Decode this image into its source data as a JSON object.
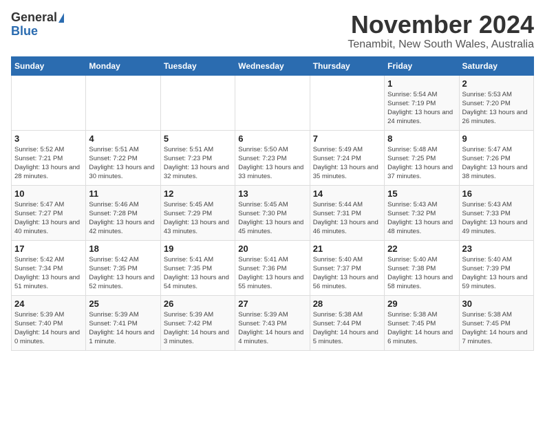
{
  "logo": {
    "general": "General",
    "blue": "Blue"
  },
  "title": {
    "month": "November 2024",
    "location": "Tenambit, New South Wales, Australia"
  },
  "days_of_week": [
    "Sunday",
    "Monday",
    "Tuesday",
    "Wednesday",
    "Thursday",
    "Friday",
    "Saturday"
  ],
  "weeks": [
    [
      {
        "day": "",
        "info": ""
      },
      {
        "day": "",
        "info": ""
      },
      {
        "day": "",
        "info": ""
      },
      {
        "day": "",
        "info": ""
      },
      {
        "day": "",
        "info": ""
      },
      {
        "day": "1",
        "info": "Sunrise: 5:54 AM\nSunset: 7:19 PM\nDaylight: 13 hours\nand 24 minutes."
      },
      {
        "day": "2",
        "info": "Sunrise: 5:53 AM\nSunset: 7:20 PM\nDaylight: 13 hours\nand 26 minutes."
      }
    ],
    [
      {
        "day": "3",
        "info": "Sunrise: 5:52 AM\nSunset: 7:21 PM\nDaylight: 13 hours\nand 28 minutes."
      },
      {
        "day": "4",
        "info": "Sunrise: 5:51 AM\nSunset: 7:22 PM\nDaylight: 13 hours\nand 30 minutes."
      },
      {
        "day": "5",
        "info": "Sunrise: 5:51 AM\nSunset: 7:23 PM\nDaylight: 13 hours\nand 32 minutes."
      },
      {
        "day": "6",
        "info": "Sunrise: 5:50 AM\nSunset: 7:23 PM\nDaylight: 13 hours\nand 33 minutes."
      },
      {
        "day": "7",
        "info": "Sunrise: 5:49 AM\nSunset: 7:24 PM\nDaylight: 13 hours\nand 35 minutes."
      },
      {
        "day": "8",
        "info": "Sunrise: 5:48 AM\nSunset: 7:25 PM\nDaylight: 13 hours\nand 37 minutes."
      },
      {
        "day": "9",
        "info": "Sunrise: 5:47 AM\nSunset: 7:26 PM\nDaylight: 13 hours\nand 38 minutes."
      }
    ],
    [
      {
        "day": "10",
        "info": "Sunrise: 5:47 AM\nSunset: 7:27 PM\nDaylight: 13 hours\nand 40 minutes."
      },
      {
        "day": "11",
        "info": "Sunrise: 5:46 AM\nSunset: 7:28 PM\nDaylight: 13 hours\nand 42 minutes."
      },
      {
        "day": "12",
        "info": "Sunrise: 5:45 AM\nSunset: 7:29 PM\nDaylight: 13 hours\nand 43 minutes."
      },
      {
        "day": "13",
        "info": "Sunrise: 5:45 AM\nSunset: 7:30 PM\nDaylight: 13 hours\nand 45 minutes."
      },
      {
        "day": "14",
        "info": "Sunrise: 5:44 AM\nSunset: 7:31 PM\nDaylight: 13 hours\nand 46 minutes."
      },
      {
        "day": "15",
        "info": "Sunrise: 5:43 AM\nSunset: 7:32 PM\nDaylight: 13 hours\nand 48 minutes."
      },
      {
        "day": "16",
        "info": "Sunrise: 5:43 AM\nSunset: 7:33 PM\nDaylight: 13 hours\nand 49 minutes."
      }
    ],
    [
      {
        "day": "17",
        "info": "Sunrise: 5:42 AM\nSunset: 7:34 PM\nDaylight: 13 hours\nand 51 minutes."
      },
      {
        "day": "18",
        "info": "Sunrise: 5:42 AM\nSunset: 7:35 PM\nDaylight: 13 hours\nand 52 minutes."
      },
      {
        "day": "19",
        "info": "Sunrise: 5:41 AM\nSunset: 7:35 PM\nDaylight: 13 hours\nand 54 minutes."
      },
      {
        "day": "20",
        "info": "Sunrise: 5:41 AM\nSunset: 7:36 PM\nDaylight: 13 hours\nand 55 minutes."
      },
      {
        "day": "21",
        "info": "Sunrise: 5:40 AM\nSunset: 7:37 PM\nDaylight: 13 hours\nand 56 minutes."
      },
      {
        "day": "22",
        "info": "Sunrise: 5:40 AM\nSunset: 7:38 PM\nDaylight: 13 hours\nand 58 minutes."
      },
      {
        "day": "23",
        "info": "Sunrise: 5:40 AM\nSunset: 7:39 PM\nDaylight: 13 hours\nand 59 minutes."
      }
    ],
    [
      {
        "day": "24",
        "info": "Sunrise: 5:39 AM\nSunset: 7:40 PM\nDaylight: 14 hours\nand 0 minutes."
      },
      {
        "day": "25",
        "info": "Sunrise: 5:39 AM\nSunset: 7:41 PM\nDaylight: 14 hours\nand 1 minute."
      },
      {
        "day": "26",
        "info": "Sunrise: 5:39 AM\nSunset: 7:42 PM\nDaylight: 14 hours\nand 3 minutes."
      },
      {
        "day": "27",
        "info": "Sunrise: 5:39 AM\nSunset: 7:43 PM\nDaylight: 14 hours\nand 4 minutes."
      },
      {
        "day": "28",
        "info": "Sunrise: 5:38 AM\nSunset: 7:44 PM\nDaylight: 14 hours\nand 5 minutes."
      },
      {
        "day": "29",
        "info": "Sunrise: 5:38 AM\nSunset: 7:45 PM\nDaylight: 14 hours\nand 6 minutes."
      },
      {
        "day": "30",
        "info": "Sunrise: 5:38 AM\nSunset: 7:45 PM\nDaylight: 14 hours\nand 7 minutes."
      }
    ]
  ]
}
